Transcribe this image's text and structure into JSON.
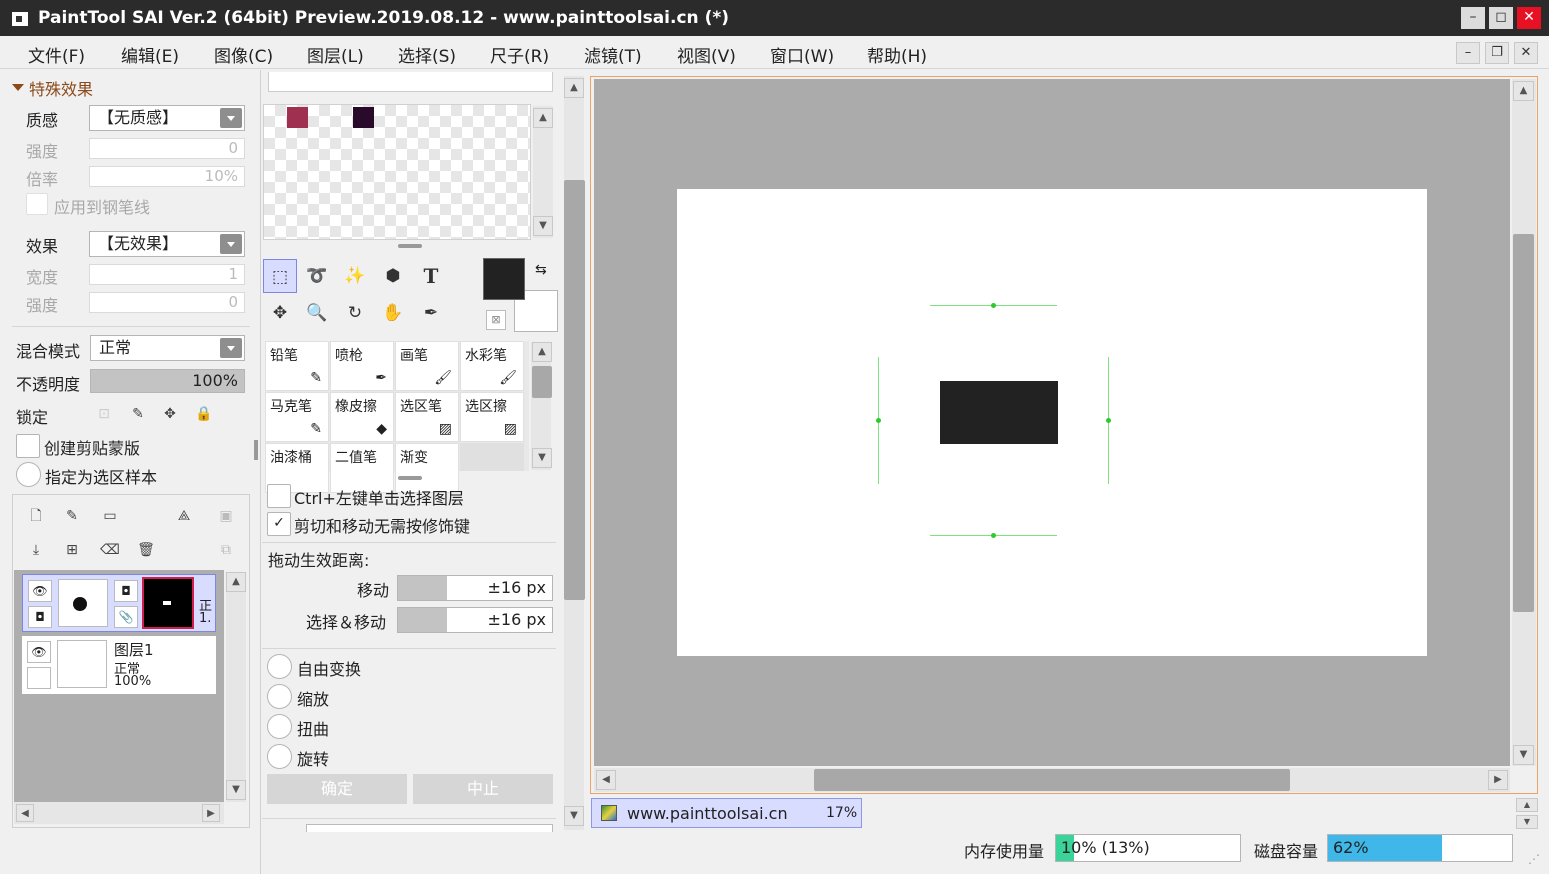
{
  "window": {
    "title": "PaintTool SAI Ver.2 (64bit) Preview.2019.08.12 - www.painttoolsai.cn (*)",
    "btn_min": "–",
    "btn_max": "◻",
    "btn_close": "✕"
  },
  "menu": {
    "items": [
      "文件(F)",
      "编辑(E)",
      "图像(C)",
      "图层(L)",
      "选择(S)",
      "尺子(R)",
      "滤镜(T)",
      "视图(V)",
      "窗口(W)",
      "帮助(H)"
    ],
    "mdi_min": "–",
    "mdi_restore": "❐",
    "mdi_close": "✕"
  },
  "effects": {
    "header": "特殊效果",
    "texture_label": "质感",
    "texture_value": "【无质感】",
    "strength_label": "强度",
    "strength_value": "0",
    "scale_label": "倍率",
    "scale_value": "10%",
    "apply_pen_label": "应用到钢笔线",
    "effect_label": "效果",
    "effect_value": "【无效果】",
    "width_label": "宽度",
    "width_value": "1",
    "strength2_label": "强度",
    "strength2_value": "0"
  },
  "layer_props": {
    "blend_label": "混合模式",
    "blend_value": "正常",
    "opacity_label": "不透明度",
    "opacity_value": "100%",
    "opacity_fraction": 1.0,
    "lock_label": "锁定",
    "clip_label": "创建剪贴蒙版",
    "sample_label": "指定为选区样本"
  },
  "layers": [
    {
      "name": "",
      "mode": "正",
      "opacity": "1."
    },
    {
      "name": "图层1",
      "mode": "正常",
      "opacity": "100%"
    }
  ],
  "colors": {
    "swatch1": "#a0304f",
    "swatch2": "#2a0a2a",
    "primary": "#222222",
    "secondary": "#ffffff",
    "accent_blue": "#3fb8e9",
    "accent_green": "#3ad49a"
  },
  "tools": {
    "row1": [
      "select-rect",
      "lasso",
      "magic-wand",
      "shape",
      "T"
    ],
    "row2": [
      "move",
      "zoom",
      "rotate",
      "hand",
      "eyedropper"
    ]
  },
  "brushes": [
    {
      "name": "铅笔",
      "icon": "✎"
    },
    {
      "name": "喷枪",
      "icon": "✒"
    },
    {
      "name": "画笔",
      "icon": "🖌"
    },
    {
      "name": "水彩笔",
      "icon": "🖌"
    },
    {
      "name": "马克笔",
      "icon": "✎"
    },
    {
      "name": "橡皮擦",
      "icon": "◆"
    },
    {
      "name": "选区笔",
      "icon": "▨"
    },
    {
      "name": "选区擦",
      "icon": "▨"
    },
    {
      "name": "油漆桶",
      "icon": ""
    },
    {
      "name": "二值笔",
      "icon": ""
    },
    {
      "name": "渐变",
      "icon": ""
    }
  ],
  "options": {
    "ctrl_click_label": "Ctrl+左键单击选择图层",
    "cut_move_label": "剪切和移动无需按修饰键",
    "cut_move_check": "✓",
    "drag_label": "拖动生效距离:",
    "move_label": "移动",
    "move_value": "±16 px",
    "selmove_label": "选择＆移动",
    "selmove_value": "±16 px",
    "free_transform": "自由变换",
    "scale": "缩放",
    "distort": "扭曲",
    "rotate": "旋转",
    "ok_label": "确定",
    "cancel_label": "中止"
  },
  "canvas_tab": {
    "name": "www.painttoolsai.cn",
    "zoom": "17%"
  },
  "status": {
    "memory_label": "内存使用量",
    "memory_value": "10% (13%)",
    "memory_fraction": 0.1,
    "disk_label": "磁盘容量",
    "disk_value": "62%",
    "disk_fraction": 0.62
  }
}
